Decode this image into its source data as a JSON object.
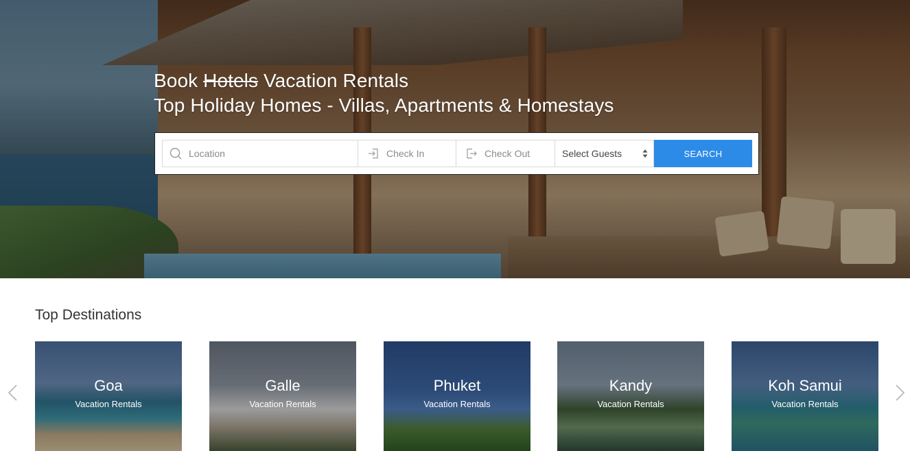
{
  "hero": {
    "title_line1_prefix": "Book",
    "title_line1_struck": "Hotels",
    "title_line1_suffix": "Vacation Rentals",
    "title_line2": "Top Holiday Homes - Villas, Apartments & Homestays"
  },
  "search": {
    "location_placeholder": "Location",
    "checkin_placeholder": "Check In",
    "checkout_placeholder": "Check Out",
    "guests_label": "Select Guests",
    "button_label": "SEARCH",
    "button_color": "#2d8be8",
    "icons": {
      "location": "search-icon",
      "checkin": "sign-in-icon",
      "checkout": "sign-out-icon",
      "guests": "select-arrows-icon"
    }
  },
  "destinations": {
    "title": "Top Destinations",
    "items": [
      {
        "name": "Goa",
        "subtitle": "Vacation Rentals"
      },
      {
        "name": "Galle",
        "subtitle": "Vacation Rentals"
      },
      {
        "name": "Phuket",
        "subtitle": "Vacation Rentals"
      },
      {
        "name": "Kandy",
        "subtitle": "Vacation Rentals"
      },
      {
        "name": "Koh Samui",
        "subtitle": "Vacation Rentals"
      }
    ],
    "prev_icon": "chevron-left-icon",
    "next_icon": "chevron-right-icon"
  }
}
